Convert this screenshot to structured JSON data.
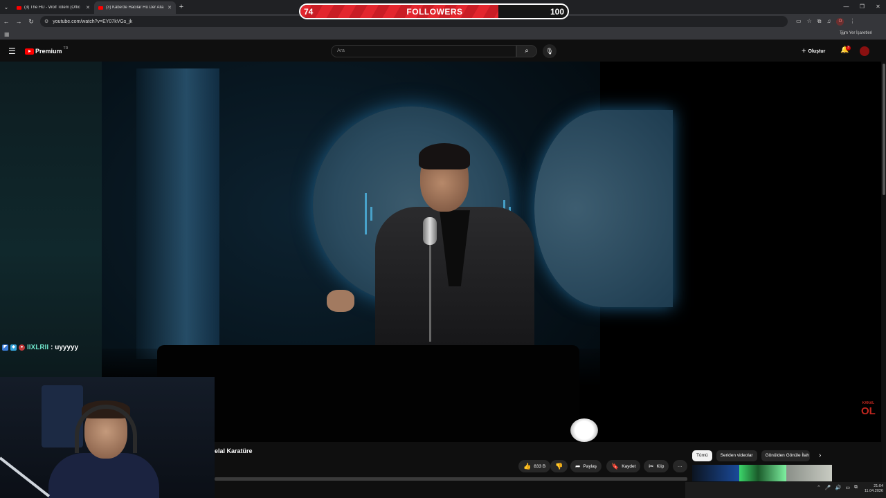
{
  "browser": {
    "tabs": [
      {
        "title": "(3) The HU - Wolf Totem (Offic",
        "active": false
      },
      {
        "title": "(3) Kâbe'de Hacılar Hû Der Alla",
        "active": true
      }
    ],
    "url": "youtube.com/watch?v=EY07kVGs_jk",
    "all_bookmarks": "Tüm Yer İşaretleri",
    "profile_initial": "O"
  },
  "followers_overlay": {
    "current": "74",
    "label": "FOLLOWERS",
    "goal": "100",
    "progress_fraction": 0.74,
    "accent": "#e3262e"
  },
  "youtube": {
    "logo_text": "Premium",
    "country": "TR",
    "search_placeholder": "Ara",
    "create_label": "Oluştur",
    "notification_count": "3"
  },
  "chat": {
    "username": "IIXLRII",
    "message": ": uyyyyy",
    "username_color": "#6fe3c9"
  },
  "video": {
    "title": "elal Karatüre",
    "like_count": "833 B",
    "share_label": "Paylaş",
    "save_label": "Kaydet",
    "clip_label": "Klip",
    "more_label": "···",
    "watermark_main": "OL",
    "watermark_top": "KANAL"
  },
  "recommendations": {
    "chips": [
      "Tümü",
      "Seriden videolar",
      "Gönülden Gönüle İlah"
    ]
  },
  "taskbar": {
    "time": "21:04",
    "date": "11.04.2026"
  }
}
